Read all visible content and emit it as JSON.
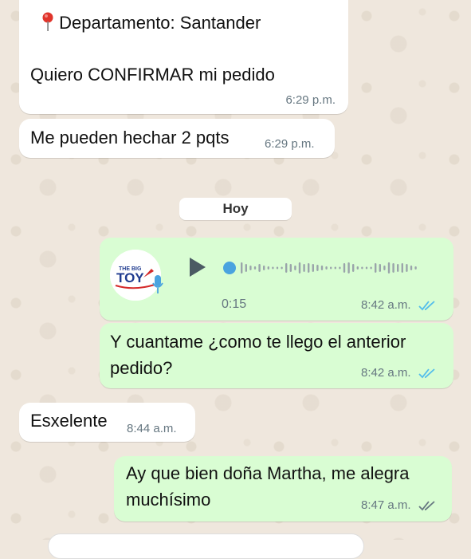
{
  "messages": [
    {
      "type": "location-text",
      "pin_text": "Departamento: Santander",
      "text": "Quiero CONFIRMAR mi pedido",
      "time": "6:29 p.m."
    },
    {
      "type": "text-in",
      "text": "Me pueden hechar 2 pqts",
      "time": "6:29 p.m."
    },
    {
      "type": "date",
      "text": "Hoy"
    },
    {
      "type": "voice-out",
      "logo_small": "THE BIG",
      "logo_big": "TOY",
      "duration": "0:15",
      "time": "8:42 a.m.",
      "status": "read"
    },
    {
      "type": "text-out",
      "line1": "Y cuantame ¿como te llego el anterior",
      "line2": "pedido?",
      "time": "8:42 a.m.",
      "status": "read"
    },
    {
      "type": "text-in",
      "text": "Esxelente",
      "time": "8:44 a.m."
    },
    {
      "type": "text-out",
      "line1": "Ay que bien doña Martha, me alegra",
      "line2": "muchísimo",
      "time": "8:47 a.m.",
      "status": "delivered"
    }
  ],
  "colors": {
    "incoming": "#ffffff",
    "outgoing": "#d9fdd3",
    "read_ticks": "#53bdeb",
    "delivered_ticks": "#667781",
    "wallpaper": "#efe7dd",
    "voice_dot": "#4aa3df"
  },
  "icons": {
    "pin": "location-pin-icon",
    "play": "play-icon",
    "mic": "microphone-icon",
    "ticks": "double-check-icon"
  }
}
